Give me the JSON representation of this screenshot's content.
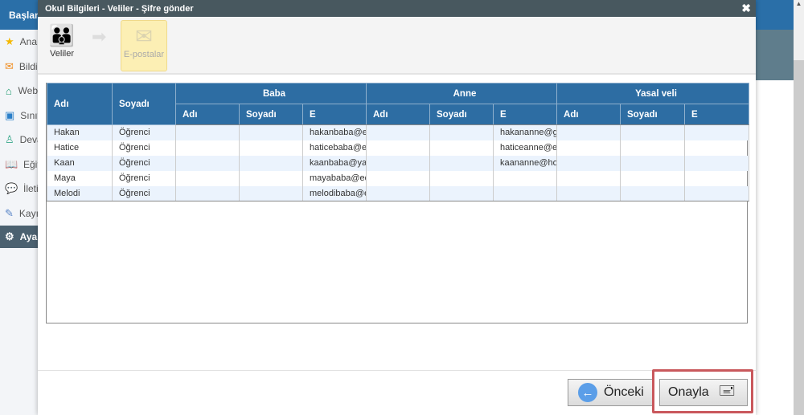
{
  "sidebar": {
    "header": "Başlangıç",
    "items": [
      {
        "label": "Ana sayfa",
        "icon": "star-icon",
        "color": "#f5b800"
      },
      {
        "label": "Bildirimler",
        "icon": "mail-icon",
        "color": "#f08c1e"
      },
      {
        "label": "Web",
        "icon": "home-icon",
        "color": "#1a9a6c"
      },
      {
        "label": "Sınıflar",
        "icon": "book-icon",
        "color": "#2a7fc9"
      },
      {
        "label": "Devam",
        "icon": "user-icon",
        "color": "#36a88a"
      },
      {
        "label": "Eğitim",
        "icon": "open-book-icon",
        "color": "#2a6fa8"
      },
      {
        "label": "İletişim",
        "icon": "chat-icon",
        "color": "#d93a2b"
      },
      {
        "label": "Kayıt",
        "icon": "pen-icon",
        "color": "#5a86c8"
      },
      {
        "label": "Ayarlar",
        "icon": "gear-icon",
        "color": "#ffffff"
      }
    ]
  },
  "dialog": {
    "title": "Okul Bilgileri - Veliler - Şifre gönder",
    "close": "✖",
    "steps": [
      {
        "label": "Veliler"
      },
      {
        "label": "E-postalar"
      }
    ],
    "table": {
      "columns": {
        "name": "Adı",
        "surname": "Soyadı"
      },
      "groups": [
        "Baba",
        "Anne",
        "Yasal veli"
      ],
      "subcols": [
        "Adı",
        "Soyadı",
        "E"
      ],
      "rows": [
        [
          "Hakan",
          "Öğrenci",
          "",
          "",
          "hakanbaba@ed",
          "",
          "",
          "hakananne@gr",
          "",
          "",
          ""
        ],
        [
          "Hatice",
          "Öğrenci",
          "",
          "",
          "haticebaba@ed",
          "",
          "",
          "haticeanne@ed",
          "",
          "",
          ""
        ],
        [
          "Kaan",
          "Öğrenci",
          "",
          "",
          "kaanbaba@yah",
          "",
          "",
          "kaananne@hot",
          "",
          "",
          ""
        ],
        [
          "Maya",
          "Öğrenci",
          "",
          "",
          "mayababa@ed",
          "",
          "",
          "",
          "",
          "",
          ""
        ],
        [
          "Melodi",
          "Öğrenci",
          "",
          "",
          "melodibaba@e",
          "",
          "",
          "",
          "",
          "",
          ""
        ]
      ]
    },
    "buttons": {
      "prev": "Önceki",
      "confirm": "Onayla"
    }
  }
}
